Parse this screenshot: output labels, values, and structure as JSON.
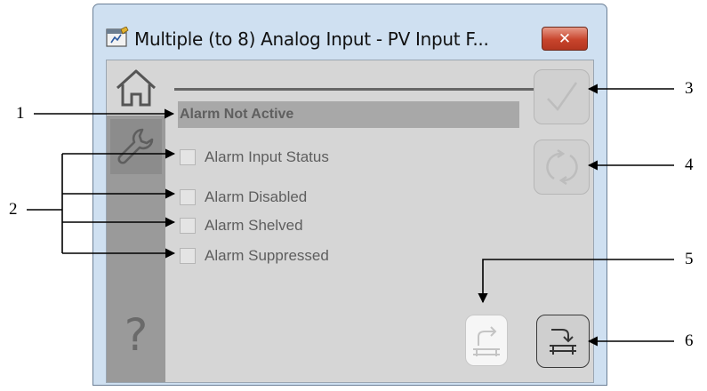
{
  "window": {
    "title": "Multiple (to 8) Analog Input - PV Input F...",
    "close_label": "✕"
  },
  "tabs": {
    "home_icon": "home-icon",
    "maintenance_icon": "wrench-icon",
    "help_label": "?"
  },
  "alarm": {
    "status_text": "Alarm Not Active"
  },
  "checkboxes": [
    {
      "label": "Alarm Input Status",
      "checked": false
    },
    {
      "label": "Alarm Disabled",
      "checked": false
    },
    {
      "label": "Alarm Shelved",
      "checked": false
    },
    {
      "label": "Alarm Suppressed",
      "checked": false
    }
  ],
  "buttons": {
    "acknowledge_icon": "checkmark-icon",
    "reset_icon": "refresh-icon",
    "shelve_icon": "shelve-icon",
    "unshelve_icon": "unshelve-icon"
  },
  "callouts": [
    "1",
    "2",
    "3",
    "4",
    "5",
    "6"
  ]
}
